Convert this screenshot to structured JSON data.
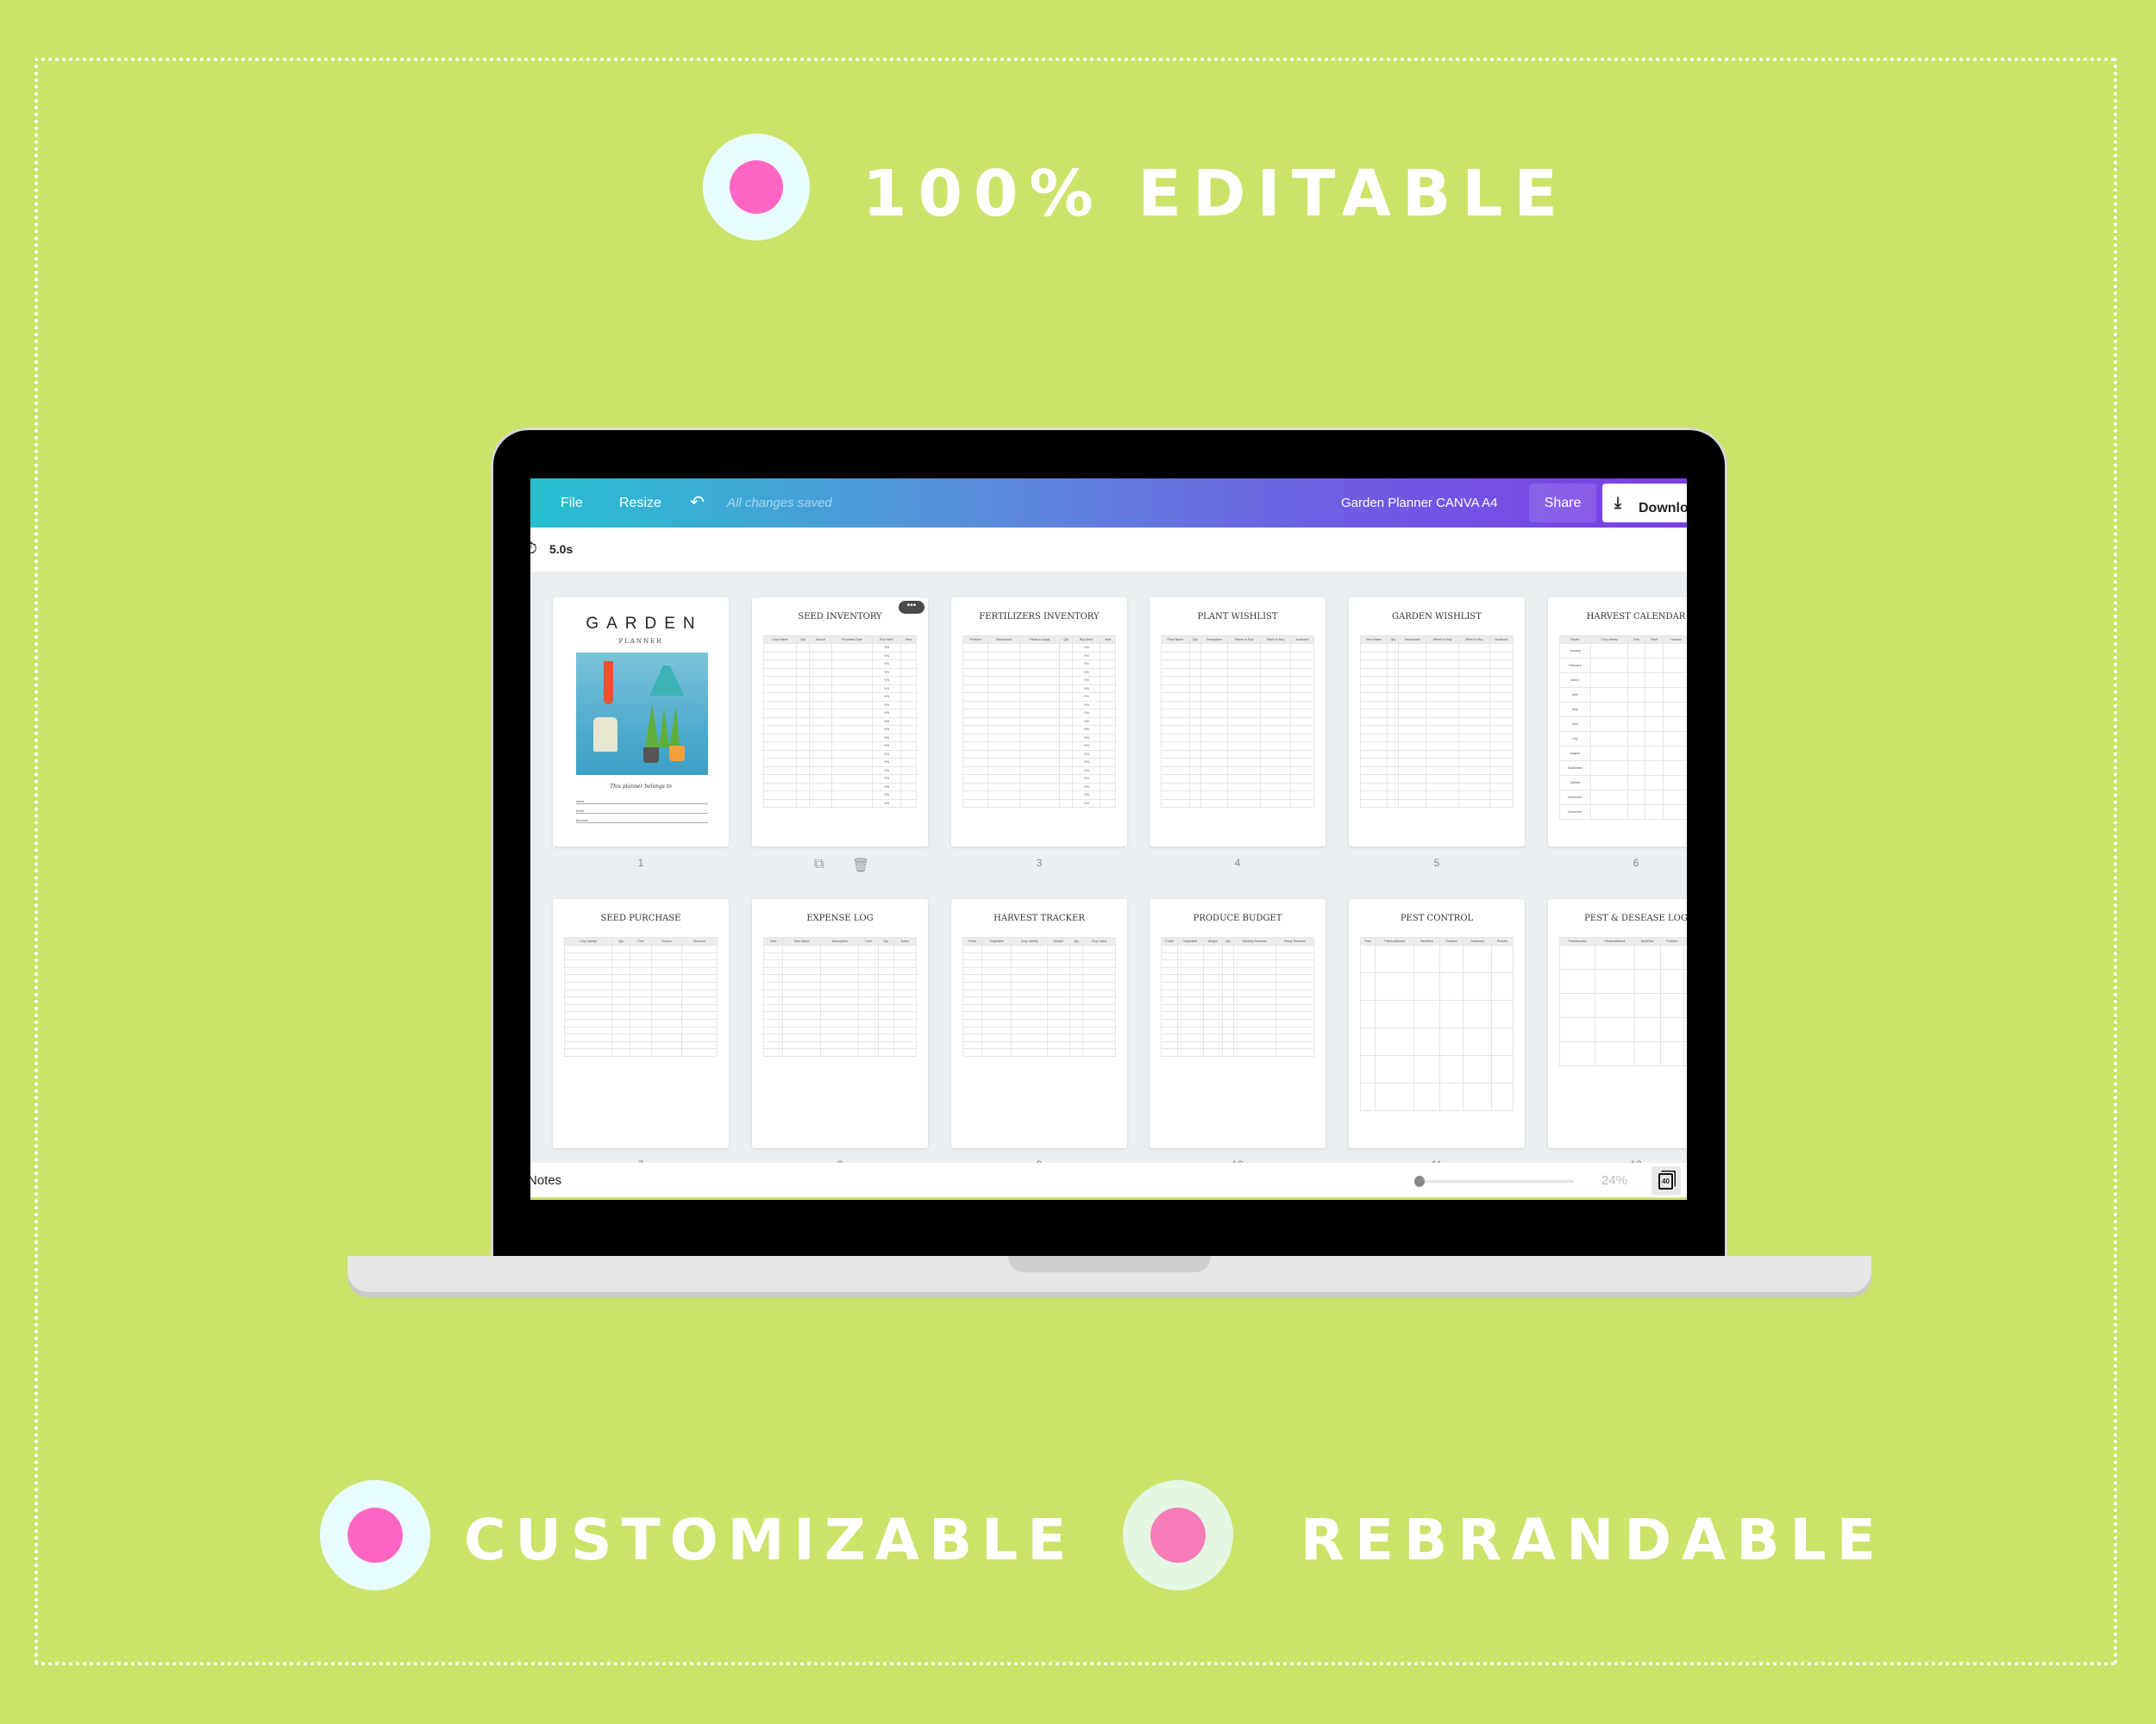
{
  "colors": {
    "background": "#cbe368",
    "badge_outer": "#e8fdfd",
    "badge_outer_alt": "#e3f7e3",
    "badge_dot": "#ff66c4",
    "badge_dot_alt": "#f77cb8",
    "toolbar_start": "#27c0d1",
    "toolbar_end": "#7c3ee6"
  },
  "headlines": {
    "top": "100% EDITABLE",
    "left": "CUSTOMIZABLE",
    "right": "REBRANDABLE"
  },
  "toolbar": {
    "file": "File",
    "resize": "Resize",
    "undo_icon": "undo-icon",
    "status": "All changes saved",
    "doc_title": "Garden Planner CANVA A4",
    "share": "Share",
    "download": "Download"
  },
  "timer": {
    "icon": "stopwatch-icon",
    "value": "5.0s"
  },
  "bottom": {
    "notes": "Notes",
    "zoom": "24%",
    "zoom_level_percent": 24,
    "page_count": "40"
  },
  "cover": {
    "title": "GARDEN",
    "subtitle": "PLANNER",
    "belongs": "This planner belongs to",
    "fields": [
      "Name",
      "Email",
      "Business"
    ]
  },
  "pages": [
    {
      "number": "1",
      "cover": true
    },
    {
      "number": "2",
      "title": "SEED INVENTORY",
      "columns": [
        "Crop Name",
        "Qty",
        "Source",
        "Purchase Date",
        "Buy More",
        "Year"
      ],
      "fill_column": 4,
      "fill_value": "Y/N",
      "selected": true
    },
    {
      "number": "3",
      "title": "FERTILIZERS INVENTORY",
      "columns": [
        "Fertilizer",
        "Description",
        "Plants to Apply",
        "Qty",
        "Buy More",
        "Year"
      ],
      "fill_column": 4,
      "fill_value": "Y/N"
    },
    {
      "number": "4",
      "title": "PLANT WISHLIST",
      "columns": [
        "Plant Name",
        "Qty",
        "Description",
        "Where to Buy",
        "When to Buy",
        "Achieved"
      ]
    },
    {
      "number": "5",
      "title": "GARDEN WISHLIST",
      "columns": [
        "Item Name",
        "Qty",
        "Description",
        "Where to Buy",
        "When to Buy",
        "Achieved"
      ]
    },
    {
      "number": "6",
      "title": "HARVEST CALENDAR",
      "columns": [
        "Month",
        "Crop Variety",
        "Sow",
        "Plant",
        "Harvest",
        "Weight"
      ],
      "row_labels": [
        "January",
        "February",
        "March",
        "April",
        "May",
        "June",
        "July",
        "August",
        "September",
        "October",
        "November",
        "December"
      ]
    },
    {
      "number": "7",
      "title": "SEED PURCHASE",
      "columns": [
        "Crop Variety",
        "Qty",
        "Cost",
        "Source",
        "Discount"
      ]
    },
    {
      "number": "8",
      "title": "EXPENSE LOG",
      "columns": [
        "Date",
        "Item Name",
        "Description",
        "Cost",
        "Qty",
        "Notes"
      ]
    },
    {
      "number": "9",
      "title": "HARVEST TRACKER",
      "columns": [
        "Fruits",
        "Vegetable",
        "Crop Variety",
        "Weight",
        "Qty",
        "Crop Value"
      ]
    },
    {
      "number": "10",
      "title": "PRODUCE BUDGET",
      "columns": [
        "Fruits",
        "Vegetable",
        "Weight",
        "Qty",
        "Monthly Revenue",
        "Yearly Revenue"
      ]
    },
    {
      "number": "11",
      "title": "PEST CONTROL",
      "columns": [
        "Pest",
        "Plants Affected",
        "Bed/Row",
        "Problem",
        "Treatment",
        "Results"
      ]
    },
    {
      "number": "12",
      "title": "PEST & DESEASE LOG",
      "columns": [
        "Pest/Disease",
        "Plants Affected",
        "Bed/Row",
        "Problem",
        "Treatment"
      ]
    }
  ]
}
